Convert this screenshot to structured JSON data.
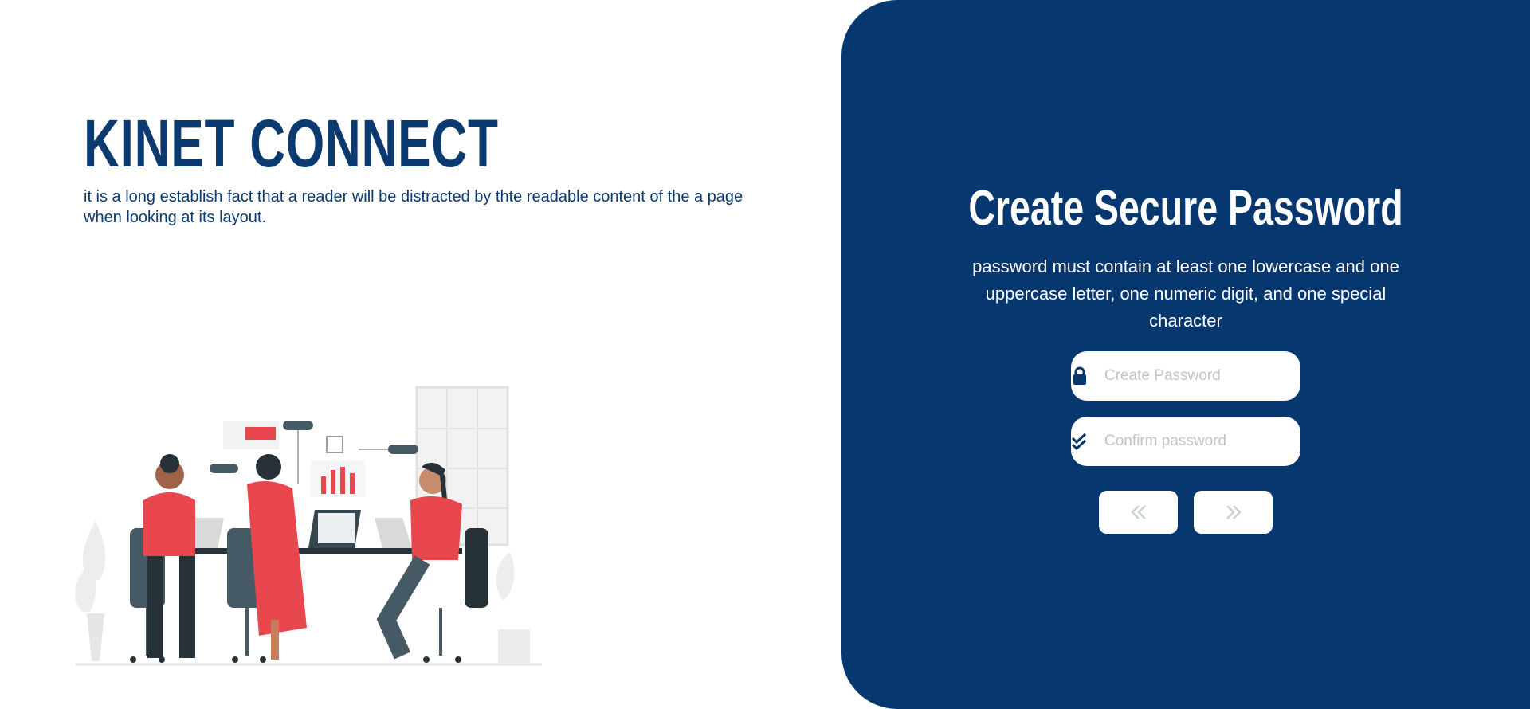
{
  "brand": {
    "title": "KINET CONNECT"
  },
  "intro": {
    "text": "it is a long establish fact that a reader will be distracted by thte readable content of the a page when looking at its layout."
  },
  "form": {
    "title": "Create Secure Password",
    "subtitle": "password must contain at least one lowercase and one uppercase letter, one numeric digit, and one special character",
    "password": {
      "placeholder": "Create Password",
      "value": "",
      "icon": "lock-icon"
    },
    "confirm": {
      "placeholder": "Confirm password",
      "value": "",
      "icon": "double-check-icon"
    },
    "prev": {
      "icon": "double-chevron-left-icon"
    },
    "next": {
      "icon": "double-chevron-right-icon"
    }
  },
  "colors": {
    "primary": "#07376f",
    "accent": "#e8474e",
    "text_on_primary": "#ffffff"
  }
}
